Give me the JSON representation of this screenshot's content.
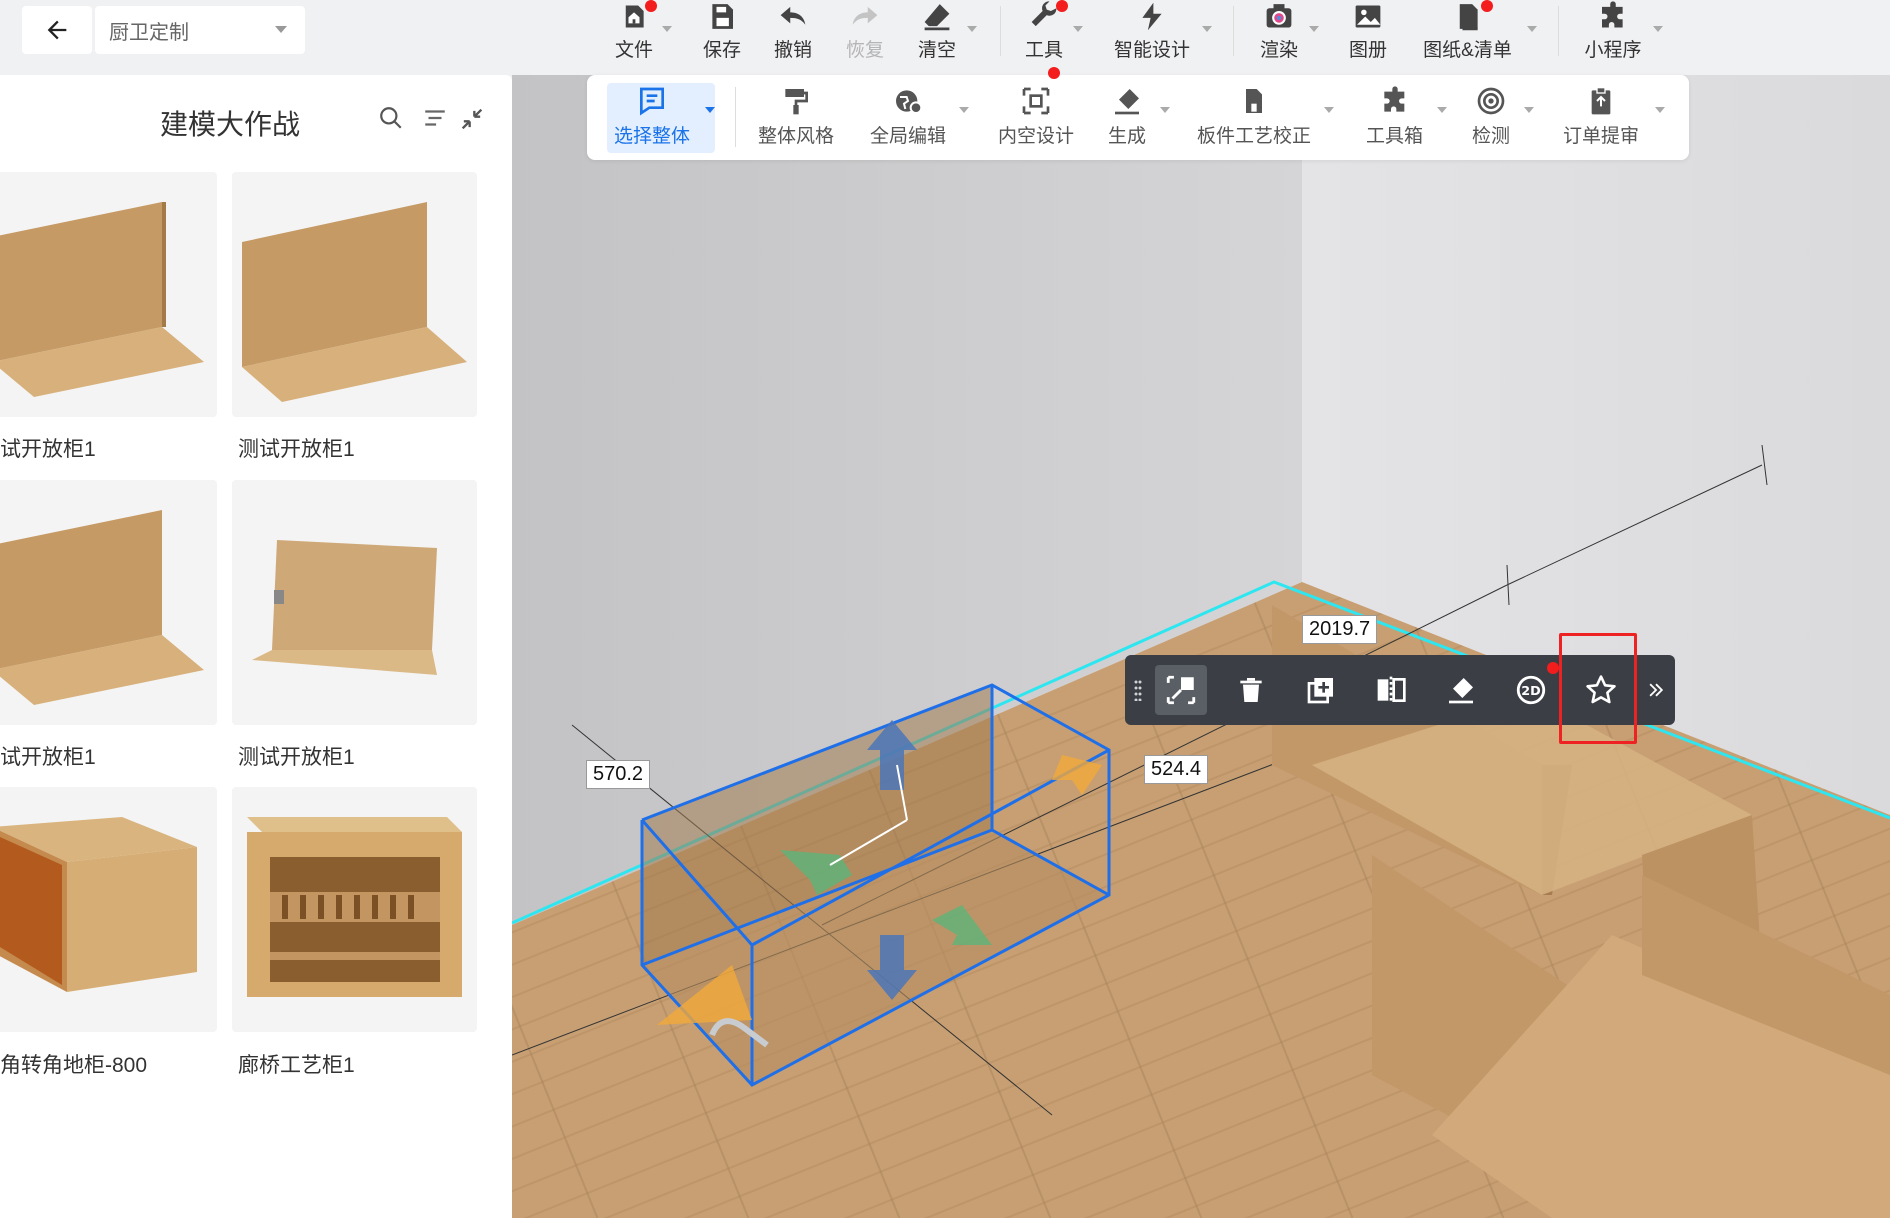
{
  "topbar": {
    "mode": "厨卫定制",
    "items": [
      {
        "label": "文件",
        "icon": "home-icon"
      },
      {
        "label": "保存",
        "icon": "save-icon"
      },
      {
        "label": "撤销",
        "icon": "undo-icon"
      },
      {
        "label": "恢复",
        "icon": "redo-icon"
      },
      {
        "label": "清空",
        "icon": "eraser-icon"
      },
      {
        "label": "工具",
        "icon": "wrench-icon"
      },
      {
        "label": "智能设计",
        "icon": "lightning-icon"
      },
      {
        "label": "渲染",
        "icon": "camera-icon"
      },
      {
        "label": "图册",
        "icon": "image-icon"
      },
      {
        "label": "图纸&清单",
        "icon": "document-icon"
      },
      {
        "label": "小程序",
        "icon": "puzzle-icon"
      }
    ]
  },
  "toolbar2": {
    "items": [
      {
        "label": "选择整体",
        "icon": "select-icon"
      },
      {
        "label": "整体风格",
        "icon": "paint-roller-icon"
      },
      {
        "label": "全局编辑",
        "icon": "globe-edit-icon"
      },
      {
        "label": "内空设计",
        "icon": "inner-space-icon"
      },
      {
        "label": "生成",
        "icon": "generate-icon"
      },
      {
        "label": "板件工艺校正",
        "icon": "board-process-icon"
      },
      {
        "label": "工具箱",
        "icon": "toolbox-icon"
      },
      {
        "label": "检测",
        "icon": "detect-icon"
      },
      {
        "label": "订单提审",
        "icon": "order-submit-icon"
      }
    ]
  },
  "leftpanel": {
    "title": "建模大作战",
    "items": [
      {
        "name": "试开放柜1"
      },
      {
        "name": "测试开放柜1"
      },
      {
        "name": "试开放柜1"
      },
      {
        "name": "测试开放柜1"
      },
      {
        "name": "角转角地柜-800"
      },
      {
        "name": "廊桥工艺柜1"
      }
    ]
  },
  "viewport": {
    "dimensions": {
      "width": "570.2",
      "depth": "524.4",
      "length": "2019.7"
    }
  },
  "actionbar": {
    "buttons": [
      "fit-selection-icon",
      "trash-icon",
      "duplicate-icon",
      "split-icon",
      "hammer-icon",
      "view-2d-icon",
      "star-icon",
      "more-icon"
    ]
  }
}
